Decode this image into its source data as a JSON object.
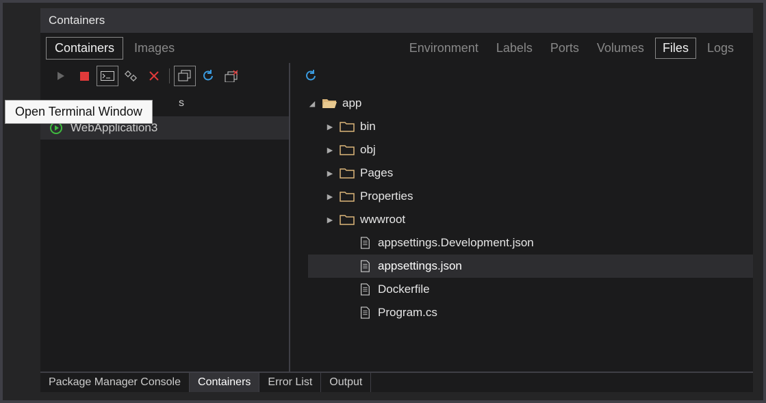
{
  "title": "Containers",
  "left_tabs": [
    "Containers",
    "Images"
  ],
  "left_tab_active": 0,
  "detail_tabs": [
    "Environment",
    "Labels",
    "Ports",
    "Volumes",
    "Files",
    "Logs"
  ],
  "detail_tab_active": 4,
  "tooltip": "Open Terminal Window",
  "hidden_list_suffix": "s",
  "container_name": "WebApplication3",
  "tree": {
    "root": "app",
    "folders": [
      "bin",
      "obj",
      "Pages",
      "Properties",
      "wwwroot"
    ],
    "files": [
      "appsettings.Development.json",
      "appsettings.json",
      "Dockerfile",
      "Program.cs"
    ],
    "selected_file_index": 1
  },
  "bottom_tabs": [
    "Package Manager Console",
    "Containers",
    "Error List",
    "Output"
  ],
  "bottom_tab_active": 1
}
